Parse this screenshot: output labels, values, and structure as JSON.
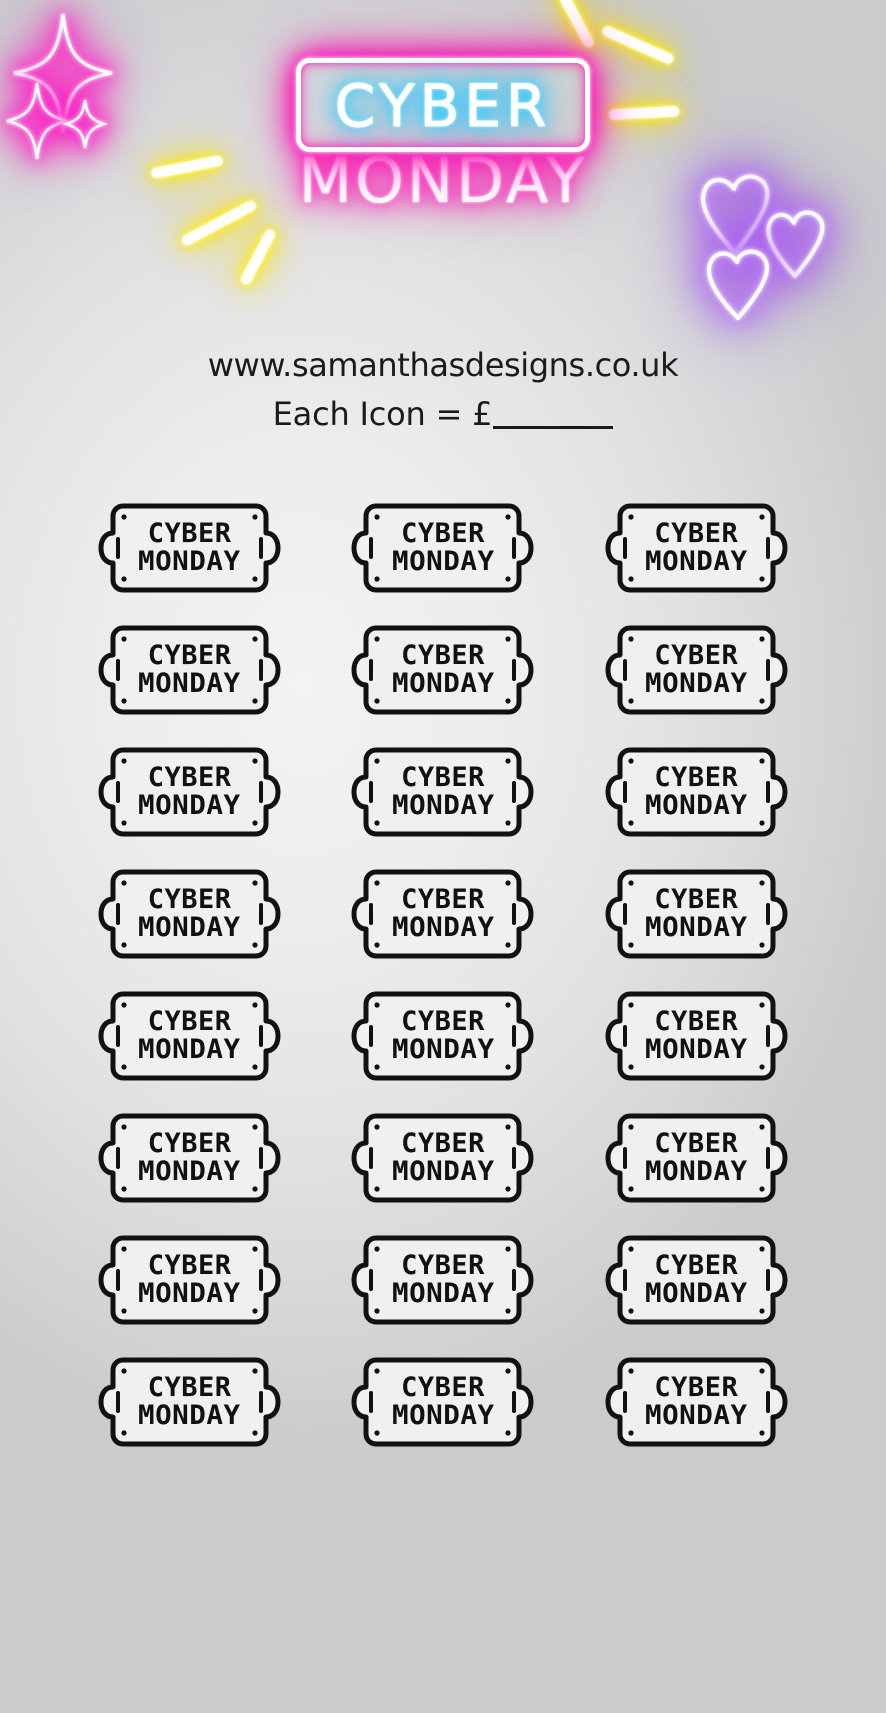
{
  "page": {
    "background_top_color": "#c9cacc",
    "background_center_color": "#eceded",
    "background_bottom_color": "#c9cbcd"
  },
  "header": {
    "neon_line1": "CYBER",
    "neon_line2": "MONDAY",
    "neon_box_color": "#ff00aa",
    "neon_line1_color": "#00b3ff",
    "neon_line2_color": "#ff00aa"
  },
  "decorations": {
    "sparkles": [
      {
        "name": "sparkle-large",
        "color": "#ff21c4"
      },
      {
        "name": "sparkle-medium",
        "color": "#ff21c4"
      },
      {
        "name": "sparkle-small",
        "color": "#ff21c4"
      }
    ],
    "dashes": [
      {
        "name": "yellow-dash-1",
        "color": "#ffe000"
      },
      {
        "name": "yellow-dash-2",
        "color": "#ffe000"
      },
      {
        "name": "yellow-dash-3",
        "color": "#ffe000"
      },
      {
        "name": "yellow-dash-4",
        "color": "#ffe000"
      },
      {
        "name": "yellow-dash-5",
        "color": "#ffe000"
      },
      {
        "name": "yellow-dash-6",
        "color": "#ffe000"
      }
    ],
    "hearts": [
      {
        "name": "heart-large",
        "color": "#a855f7"
      },
      {
        "name": "heart-small",
        "color": "#a855f7"
      },
      {
        "name": "heart-bottom",
        "color": "#a855f7"
      }
    ]
  },
  "info": {
    "website": "www.samanthasdesigns.co.uk",
    "price_label": "Each Icon = £",
    "price_value": ""
  },
  "grid": {
    "columns": 3,
    "rows": 8,
    "count": 24,
    "sticker_line1": "CYBER",
    "sticker_line2": "MONDAY",
    "stroke_color": "#111111",
    "fill_color": "#f0f0f0",
    "items": [
      {
        "line1": "CYBER",
        "line2": "MONDAY"
      },
      {
        "line1": "CYBER",
        "line2": "MONDAY"
      },
      {
        "line1": "CYBER",
        "line2": "MONDAY"
      },
      {
        "line1": "CYBER",
        "line2": "MONDAY"
      },
      {
        "line1": "CYBER",
        "line2": "MONDAY"
      },
      {
        "line1": "CYBER",
        "line2": "MONDAY"
      },
      {
        "line1": "CYBER",
        "line2": "MONDAY"
      },
      {
        "line1": "CYBER",
        "line2": "MONDAY"
      },
      {
        "line1": "CYBER",
        "line2": "MONDAY"
      },
      {
        "line1": "CYBER",
        "line2": "MONDAY"
      },
      {
        "line1": "CYBER",
        "line2": "MONDAY"
      },
      {
        "line1": "CYBER",
        "line2": "MONDAY"
      },
      {
        "line1": "CYBER",
        "line2": "MONDAY"
      },
      {
        "line1": "CYBER",
        "line2": "MONDAY"
      },
      {
        "line1": "CYBER",
        "line2": "MONDAY"
      },
      {
        "line1": "CYBER",
        "line2": "MONDAY"
      },
      {
        "line1": "CYBER",
        "line2": "MONDAY"
      },
      {
        "line1": "CYBER",
        "line2": "MONDAY"
      },
      {
        "line1": "CYBER",
        "line2": "MONDAY"
      },
      {
        "line1": "CYBER",
        "line2": "MONDAY"
      },
      {
        "line1": "CYBER",
        "line2": "MONDAY"
      },
      {
        "line1": "CYBER",
        "line2": "MONDAY"
      },
      {
        "line1": "CYBER",
        "line2": "MONDAY"
      },
      {
        "line1": "CYBER",
        "line2": "MONDAY"
      }
    ]
  }
}
